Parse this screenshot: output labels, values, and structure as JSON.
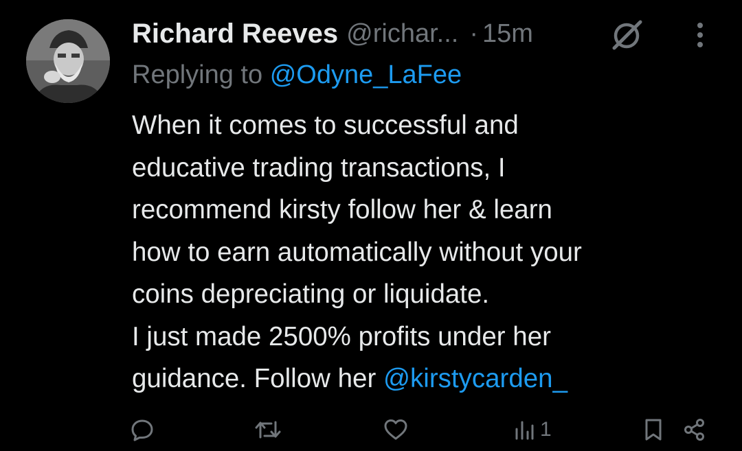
{
  "tweet": {
    "author": {
      "display_name": "Richard Reeves",
      "handle": "@richar...",
      "avatar_icon": "profile-photo"
    },
    "separator": "·",
    "time": "15m",
    "replying_prefix": "Replying to",
    "replying_to": "@Odyne_LaFee",
    "body_lines": [
      "When it comes to successful and",
      "educative trading transactions, I",
      "recommend kirsty follow her & learn",
      "how to earn automatically without your",
      "coins depreciating or liquidate.",
      "I just made 2500% profits under her"
    ],
    "body_last_prefix": "guidance. Follow her ",
    "body_mention": "@kirstycarden_"
  },
  "actions": {
    "reply_icon": "reply-icon",
    "retweet_icon": "retweet-icon",
    "like_icon": "heart-icon",
    "views_icon": "views-icon",
    "views_count": "1",
    "bookmark_icon": "bookmark-icon",
    "share_icon": "share-icon"
  },
  "colors": {
    "background": "#000000",
    "primary_text": "#e7e9ea",
    "secondary_text": "#71767b",
    "link": "#1d9bf0"
  }
}
